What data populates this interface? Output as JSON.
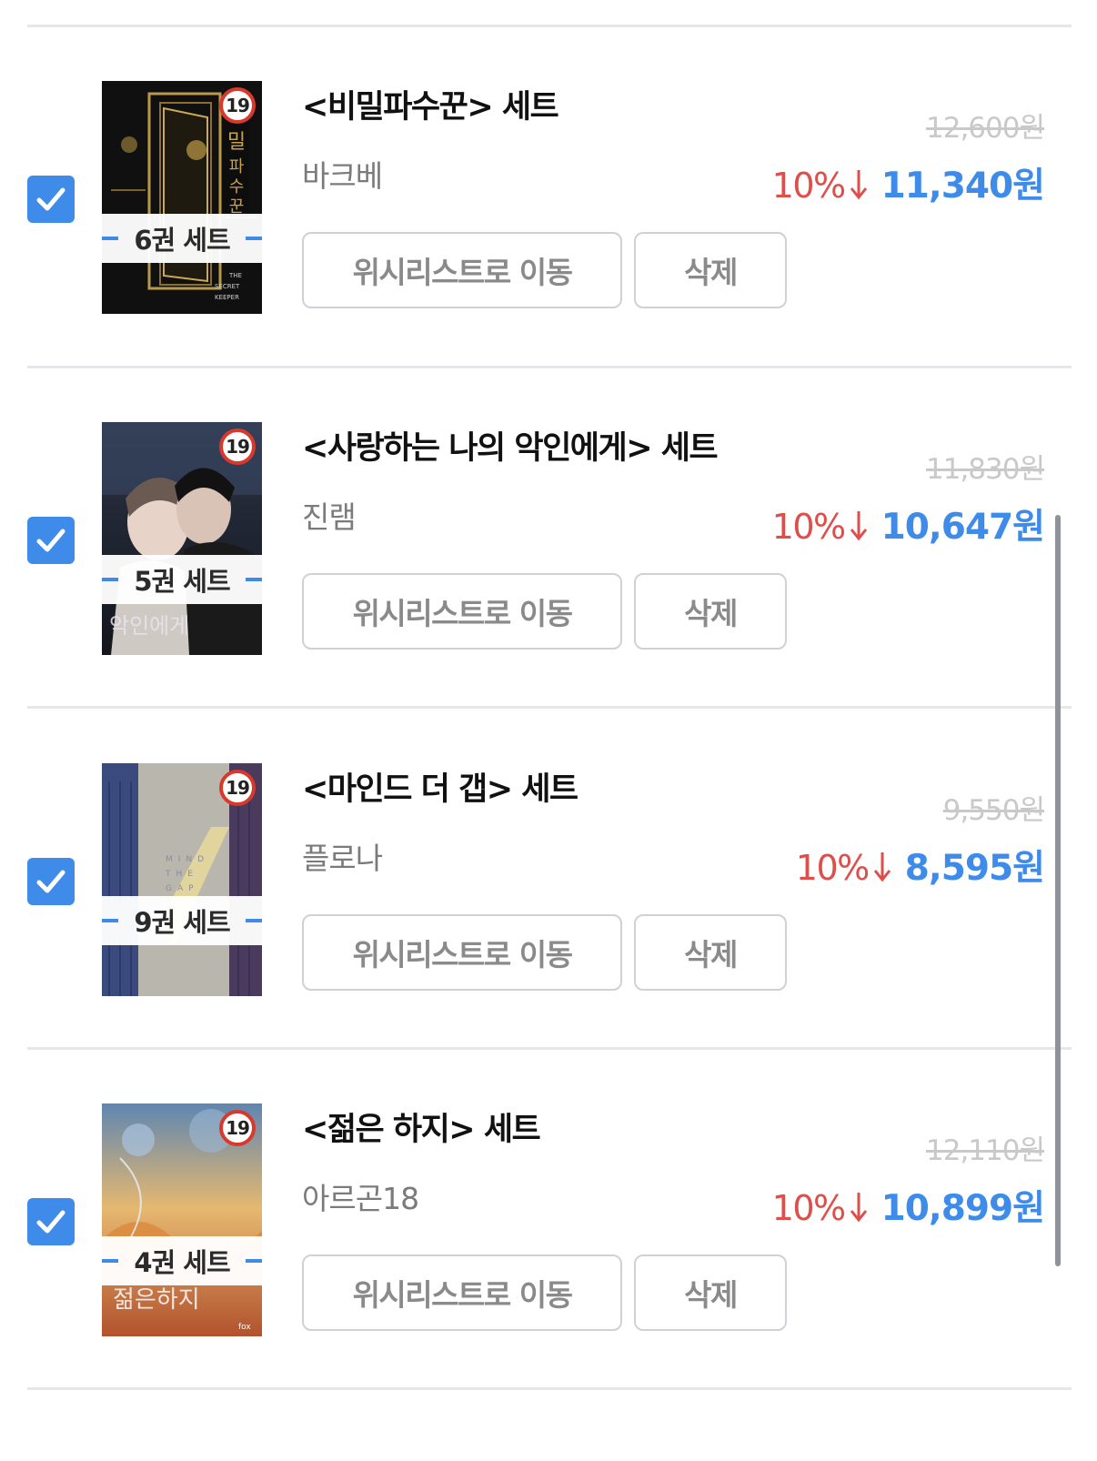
{
  "items": [
    {
      "title": "<비밀파수꾼> 세트",
      "author": "바크베",
      "set_label": "6권 세트",
      "age": "19",
      "original_price": "12,600원",
      "discount": "10%",
      "price": "11,340원",
      "wishlist_label": "위시리스트로 이동",
      "delete_label": "삭제",
      "checked": true
    },
    {
      "title": "<사랑하는 나의 악인에게> 세트",
      "author": "진램",
      "set_label": "5권 세트",
      "age": "19",
      "original_price": "11,830원",
      "discount": "10%",
      "price": "10,647원",
      "wishlist_label": "위시리스트로 이동",
      "delete_label": "삭제",
      "checked": true
    },
    {
      "title": "<마인드 더 갭> 세트",
      "author": "플로나",
      "set_label": "9권 세트",
      "age": "19",
      "original_price": "9,550원",
      "discount": "10%",
      "price": "8,595원",
      "wishlist_label": "위시리스트로 이동",
      "delete_label": "삭제",
      "checked": true
    },
    {
      "title": "<젊은 하지> 세트",
      "author": "아르곤18",
      "set_label": "4권 세트",
      "age": "19",
      "original_price": "12,110원",
      "discount": "10%",
      "price": "10,899원",
      "wishlist_label": "위시리스트로 이동",
      "delete_label": "삭제",
      "checked": true
    }
  ],
  "colors": {
    "accent": "#3f8bea",
    "discount": "#de4f4b",
    "border": "#cfd1d6"
  }
}
